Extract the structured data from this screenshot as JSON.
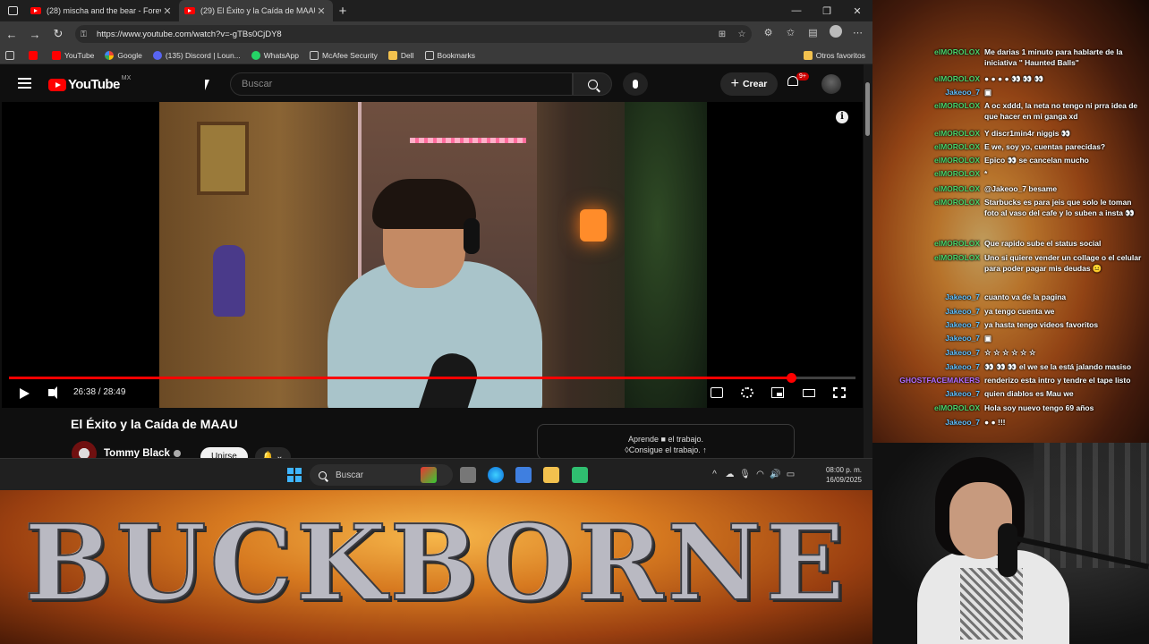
{
  "browser": {
    "tabs": [
      {
        "title": "(28) mischa and the bear - Forev",
        "active": false
      },
      {
        "title": "(29) El Éxito y la Caída de MAAU",
        "active": true
      }
    ],
    "url": "https://www.youtube.com/watch?v=-gTBs0CjDY8",
    "bookmarks": [
      "YouTube",
      "Google",
      "(135) Discord | Loun...",
      "WhatsApp",
      "McAfee Security",
      "Dell",
      "Bookmarks"
    ],
    "other_bookmarks": "Otros favoritos"
  },
  "youtube": {
    "logo_text": "YouTube",
    "region": "MX",
    "search_placeholder": "Buscar",
    "create_label": "Crear",
    "notification_badge": "9+",
    "player": {
      "current_time": "26:38",
      "duration": "28:49",
      "time_display": "26:38 / 28:49",
      "progress_fraction": 0.924
    },
    "video_title": "El Éxito y la Caída de MAAU",
    "channel_name": "Tommy Black",
    "join_label": "Unirse",
    "ad_line1": "Aprende ■ el trabajo.",
    "ad_line2": "◊Consigue el trabajo. ↑"
  },
  "taskbar": {
    "search_placeholder": "Buscar",
    "time": "08:00 p. m.",
    "date": "16/09/2025"
  },
  "chat": {
    "messages": [
      {
        "user": "elMOROLOX",
        "text": "Me darias 1 minuto para hablarte de la iniciativa \" Haunted Balls\"",
        "role": "el"
      },
      {
        "user": "elMOROLOX",
        "text": "● ● ● ● 👀 👀 👀",
        "role": "el"
      },
      {
        "user": "Jakeoo_7",
        "text": "▣",
        "role": "ja"
      },
      {
        "user": "elMOROLOX",
        "text": "A oc xddd, la neta no tengo ni prra idea de que hacer en mi ganga xd",
        "role": "el"
      },
      {
        "user": "elMOROLOX",
        "text": "Y discr1min4r niggis 👀",
        "role": "el"
      },
      {
        "user": "elMOROLOX",
        "text": "E we, soy yo, cuentas parecidas?",
        "role": "el"
      },
      {
        "user": "elMOROLOX",
        "text": "Epico 👀 se cancelan mucho",
        "role": "el"
      },
      {
        "user": "elMOROLOX",
        "text": "*",
        "role": "el"
      },
      {
        "user": "elMOROLOX",
        "text": "@Jakeoo_7 besame",
        "role": "el"
      },
      {
        "user": "elMOROLOX",
        "text": "Starbucks es para jeis que solo le toman foto al vaso del cafe y lo suben a insta 👀",
        "role": "el"
      },
      {
        "user": "elMOROLOX",
        "text": "Que rapido sube el status social",
        "role": "el"
      },
      {
        "user": "elMOROLOX",
        "text": "Uno si quiere vender un collage o el celular para poder pagar mis deudas 😐",
        "role": "el"
      },
      {
        "user": "Jakeoo_7",
        "text": "cuanto va de la pagina",
        "role": "ja"
      },
      {
        "user": "Jakeoo_7",
        "text": "ya tengo cuenta we",
        "role": "ja"
      },
      {
        "user": "Jakeoo_7",
        "text": "ya hasta tengo videos favoritos",
        "role": "ja"
      },
      {
        "user": "Jakeoo_7",
        "text": "▣",
        "role": "ja"
      },
      {
        "user": "Jakeoo_7",
        "text": "☆ ☆ ☆ ☆ ☆ ☆",
        "role": "ja"
      },
      {
        "user": "Jakeoo_7",
        "text": "👀 👀 👀 el we se la está jalando masiso",
        "role": "ja"
      },
      {
        "user": "GHOSTFACEMAKERS",
        "text": "renderizo esta intro y tendre el tape listo",
        "role": "ro"
      },
      {
        "user": "Jakeoo_7",
        "text": "quien diablos es Mau we",
        "role": "ja"
      },
      {
        "user": "elMOROLOX",
        "text": "Hola soy nuevo tengo 69 años",
        "role": "el"
      },
      {
        "user": "Jakeoo_7",
        "text": "● ● !!!",
        "role": "ja"
      }
    ]
  },
  "banner": {
    "text": "BUCKBORNE"
  },
  "colors": {
    "youtube_red": "#ff0000",
    "chat_user_green": "#4ad36a",
    "chat_user_blue": "#5ec0ff",
    "chat_user_purple": "#b06cff",
    "banner_orange": "#d77a20"
  }
}
